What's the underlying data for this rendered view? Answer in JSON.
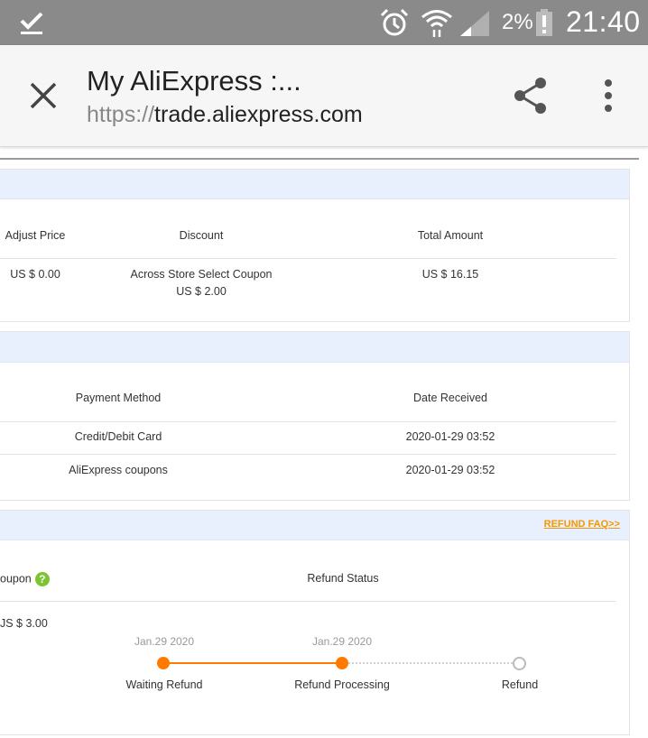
{
  "status_bar": {
    "battery_percent": "2%",
    "time": "21:40",
    "icons": [
      "download-complete-icon",
      "alarm-icon",
      "wifi-icon",
      "signal-icon",
      "battery-alert-icon"
    ]
  },
  "browser": {
    "title": "My AliExpress :...",
    "url_scheme": "https://",
    "url_host": "trade.aliexpress.com",
    "icons": [
      "close-icon",
      "share-icon",
      "more-vert-icon"
    ]
  },
  "price_section": {
    "headers": [
      "Adjust Price",
      "Discount",
      "Total Amount"
    ],
    "row": {
      "adjust_price": "US $ 0.00",
      "discount_line1": "Across Store Select Coupon",
      "discount_line2": "US $ 2.00",
      "total_amount": "US $ 16.15"
    }
  },
  "payment_section": {
    "headers": [
      "Payment Method",
      "Date Received"
    ],
    "rows": [
      {
        "method": "Credit/Debit Card",
        "date": "2020-01-29 03:52"
      },
      {
        "method": "AliExpress coupons",
        "date": "2020-01-29 03:52"
      }
    ]
  },
  "refund_section": {
    "faq_link": "REFUND FAQ>>",
    "coupon_header_partial": "oupon",
    "status_header": "Refund Status",
    "amount_partial": "JS $ 3.00",
    "timeline": [
      {
        "date": "Jan.29 2020",
        "label": "Waiting Refund",
        "done": true
      },
      {
        "date": "Jan.29 2020",
        "label": "Refund Processing",
        "done": true
      },
      {
        "date": "",
        "label": "Refund",
        "done": false
      }
    ]
  },
  "colors": {
    "status_bar": "#8a8a8a",
    "section_header": "#e8f0fd",
    "accent_orange": "#ff7a00",
    "faq_link": "#f39800",
    "help_green": "#7cc531"
  }
}
